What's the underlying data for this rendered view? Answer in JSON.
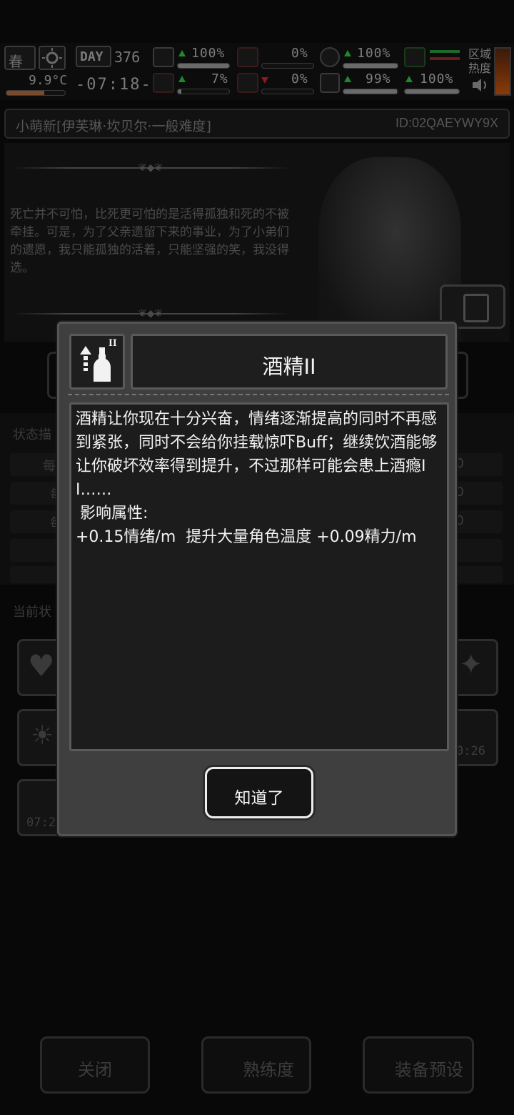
{
  "status_bar": {
    "season": "春",
    "temperature": "9.9°C",
    "day_label": "DAY",
    "day_number": "376",
    "clock": "-07:18-",
    "stats": [
      {
        "name": "health",
        "value": "100%",
        "trend": "up",
        "fill": 1.0
      },
      {
        "name": "injury",
        "value": "7%",
        "trend": "up",
        "fill": 0.07
      },
      {
        "name": "hunger",
        "value": "0%",
        "trend": "none",
        "fill": 0.0
      },
      {
        "name": "blood",
        "value": "0%",
        "trend": "down",
        "fill": 0.0
      },
      {
        "name": "stomach",
        "value": "100%",
        "trend": "up",
        "fill": 1.0
      },
      {
        "name": "mood",
        "value": "99%",
        "trend": "up",
        "fill": 0.99
      },
      {
        "name": "stamina",
        "value": "100%",
        "trend": "up",
        "fill": 1.0
      }
    ],
    "zone_heat_label": "区域热度"
  },
  "profile": {
    "name": "小萌新[伊芙琳·坎贝尔·一般难度]",
    "id": "ID:02QAEYWY9X"
  },
  "story": {
    "text": "死亡并不可怕，比死更可怕的是活得孤独和死的不被牵挂。可是，为了父亲遗留下来的事业，为了小弟们的遗愿，我只能孤独的活着，只能坚强的笑，我没得选。"
  },
  "background": {
    "section_status_desc": "状态描",
    "section_current": "当前状",
    "rows_left": [
      "每",
      "每",
      "每"
    ],
    "rows_right": [
      "0",
      "0",
      "0"
    ],
    "tile_times": [
      "07:2",
      "0:26"
    ]
  },
  "bottom_buttons": {
    "close": "关闭",
    "proficiency": "熟练度",
    "equipment_preset": "装备预设"
  },
  "dialog": {
    "title": "酒精II",
    "description": "酒精让你现在十分兴奋，情绪逐渐提高的同时不再感到紧张，同时不会给你挂载惊吓Buff；继续饮酒能够让你破坏效率得到提升，不过那样可能会患上酒瘾II……",
    "attributes_label": "影响属性:",
    "attributes": "+0.15情绪/m  提升大量角色温度 +0.09精力/m",
    "icon": "alcohol-bottle-icon",
    "icon_level": "II",
    "confirm_label": "知道了"
  }
}
